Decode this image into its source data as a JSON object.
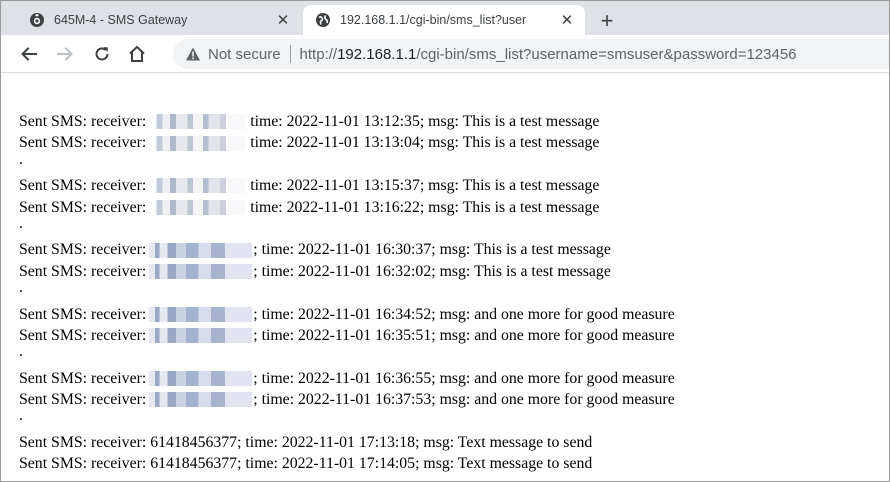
{
  "browser": {
    "tabs": [
      {
        "title": "645M-4 - SMS Gateway",
        "icon": "gateway-icon",
        "close": "✕"
      },
      {
        "title": "192.168.1.1/cgi-bin/sms_list?user",
        "icon": "globe-icon",
        "close": "✕"
      }
    ],
    "new_tab": "+",
    "security_label": "Not secure",
    "url": {
      "scheme": "http://",
      "host": "192.168.1.1",
      "rest": "/cgi-bin/sms_list?username=smsuser&password=123456"
    }
  },
  "page": {
    "lines": [
      {
        "kind": "msg",
        "prefix": "Sent SMS: receiver:",
        "redacted": true,
        "receiver": "",
        "sep": "",
        "rest": "time: 2022-11-01 13:12:35; msg: This is a test message"
      },
      {
        "kind": "msg",
        "prefix": "Sent SMS: receiver:",
        "redacted": true,
        "receiver": "",
        "sep": "",
        "rest": "time: 2022-11-01 13:13:04; msg: This is a test message"
      },
      {
        "kind": "dot",
        "text": "."
      },
      {
        "kind": "msg",
        "prefix": "Sent SMS: receiver:",
        "redacted": true,
        "receiver": "",
        "sep": "",
        "rest": "time: 2022-11-01 13:15:37; msg: This is a test message"
      },
      {
        "kind": "msg",
        "prefix": "Sent SMS: receiver:",
        "redacted": true,
        "receiver": "",
        "sep": "",
        "rest": "time: 2022-11-01 13:16:22; msg: This is a test message"
      },
      {
        "kind": "dot",
        "text": "."
      },
      {
        "kind": "msg",
        "prefix": "Sent SMS: receiver:",
        "redacted": true,
        "receiver": "",
        "sep": ";",
        "rest": "time: 2022-11-01 16:30:37; msg: This is a test message"
      },
      {
        "kind": "msg",
        "prefix": "Sent SMS: receiver:",
        "redacted": true,
        "receiver": "",
        "sep": ";",
        "rest": "time: 2022-11-01 16:32:02; msg: This is a test message"
      },
      {
        "kind": "dot",
        "text": "."
      },
      {
        "kind": "msg",
        "prefix": "Sent SMS: receiver:",
        "redacted": true,
        "receiver": "",
        "sep": ";",
        "rest": "time: 2022-11-01 16:34:52; msg: and one more for good measure"
      },
      {
        "kind": "msg",
        "prefix": "Sent SMS: receiver:",
        "redacted": true,
        "receiver": "",
        "sep": ";",
        "rest": "time: 2022-11-01 16:35:51; msg: and one more for good measure"
      },
      {
        "kind": "dot",
        "text": "."
      },
      {
        "kind": "msg",
        "prefix": "Sent SMS: receiver:",
        "redacted": true,
        "receiver": "",
        "sep": ";",
        "rest": "time: 2022-11-01 16:36:55; msg: and one more for good measure"
      },
      {
        "kind": "msg",
        "prefix": "Sent SMS: receiver:",
        "redacted": true,
        "receiver": "",
        "sep": ";",
        "rest": "time: 2022-11-01 16:37:53; msg: and one more for good measure"
      },
      {
        "kind": "dot",
        "text": "."
      },
      {
        "kind": "msg",
        "prefix": "Sent SMS: receiver:",
        "redacted": false,
        "receiver": "61418456377",
        "sep": ";",
        "rest": "time: 2022-11-01 17:13:18; msg: Text message to send"
      },
      {
        "kind": "msg",
        "prefix": "Sent SMS: receiver:",
        "redacted": false,
        "receiver": "61418456377",
        "sep": ";",
        "rest": "time: 2022-11-01 17:14:05; msg: Text message to send"
      }
    ]
  }
}
